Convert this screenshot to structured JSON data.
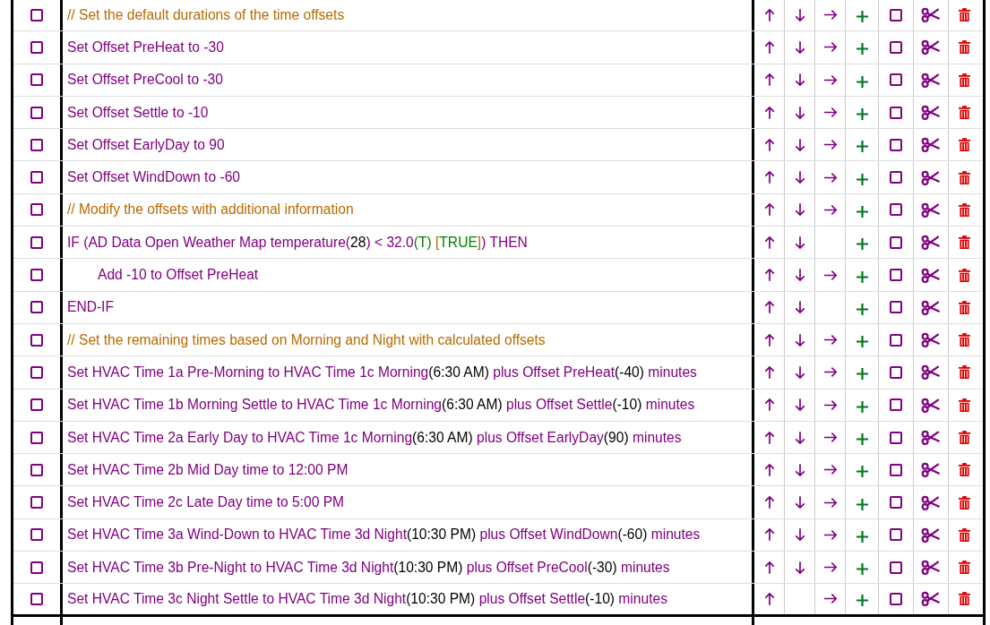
{
  "rows": [
    {
      "kind": "comment",
      "checked": false,
      "segments": [
        {
          "text": "// Set the default durations of the time offsets"
        }
      ],
      "move_up": true,
      "move_down": true,
      "indent": true,
      "marked": false
    },
    {
      "kind": "statement",
      "checked": false,
      "segments": [
        {
          "text": "Set Offset PreHeat to -30"
        }
      ],
      "move_up": true,
      "move_down": true,
      "indent": true,
      "marked": false
    },
    {
      "kind": "statement",
      "checked": false,
      "segments": [
        {
          "text": "Set Offset PreCool to -30"
        }
      ],
      "move_up": true,
      "move_down": true,
      "indent": true,
      "marked": false
    },
    {
      "kind": "statement",
      "checked": false,
      "segments": [
        {
          "text": "Set Offset Settle to -10"
        }
      ],
      "move_up": true,
      "move_down": true,
      "indent": true,
      "marked": false
    },
    {
      "kind": "statement",
      "checked": false,
      "segments": [
        {
          "text": "Set Offset EarlyDay to 90"
        }
      ],
      "move_up": true,
      "move_down": true,
      "indent": true,
      "marked": false
    },
    {
      "kind": "statement",
      "checked": false,
      "segments": [
        {
          "text": "Set Offset WindDown to -60"
        }
      ],
      "move_up": true,
      "move_down": true,
      "indent": true,
      "marked": false
    },
    {
      "kind": "comment",
      "checked": false,
      "segments": [
        {
          "text": "// Modify the offsets with additional information"
        }
      ],
      "move_up": true,
      "move_down": true,
      "indent": true,
      "marked": false
    },
    {
      "kind": "statement",
      "checked": false,
      "segments": [
        {
          "text": "IF (AD Data Open Weather Map temperature("
        },
        {
          "text": "28",
          "kind": "value"
        },
        {
          "text": ") < 32.0"
        },
        {
          "text": "(T)",
          "kind": "result"
        },
        {
          "text": " [",
          "kind": "bracket"
        },
        {
          "text": "TRUE",
          "kind": "result"
        },
        {
          "text": "]",
          "kind": "bracket"
        },
        {
          "text": ") THEN"
        }
      ],
      "move_up": true,
      "move_down": true,
      "indent": false,
      "marked": false,
      "children": [
        {
          "kind": "statement",
          "checked": false,
          "segments": [
            {
              "text": "Add -10 to Offset PreHeat"
            }
          ],
          "move_up": true,
          "move_down": true,
          "indent": true,
          "marked": false
        }
      ]
    },
    {
      "kind": "statement",
      "checked": false,
      "segments": [
        {
          "text": "END-IF"
        }
      ],
      "move_up": true,
      "move_down": true,
      "indent": false,
      "marked": false
    },
    {
      "kind": "comment",
      "checked": false,
      "segments": [
        {
          "text": "// Set the remaining times based on Morning and Night with calculated offsets"
        }
      ],
      "move_up": true,
      "move_down": true,
      "indent": true,
      "marked": false
    },
    {
      "kind": "statement",
      "checked": false,
      "segments": [
        {
          "text": "Set HVAC Time 1a Pre-Morning to HVAC Time 1c Morning"
        },
        {
          "text": "(6:30 AM)",
          "kind": "value"
        },
        {
          "text": " plus Offset PreHeat"
        },
        {
          "text": "(-40)",
          "kind": "value"
        },
        {
          "text": " minutes"
        }
      ],
      "move_up": true,
      "move_down": true,
      "indent": true,
      "marked": false
    },
    {
      "kind": "statement",
      "checked": false,
      "segments": [
        {
          "text": "Set HVAC Time 1b Morning Settle to HVAC Time 1c Morning"
        },
        {
          "text": "(6:30 AM)",
          "kind": "value"
        },
        {
          "text": " plus Offset Settle"
        },
        {
          "text": "(-10)",
          "kind": "value"
        },
        {
          "text": " minutes"
        }
      ],
      "move_up": true,
      "move_down": true,
      "indent": true,
      "marked": false
    },
    {
      "kind": "statement",
      "checked": false,
      "segments": [
        {
          "text": "Set HVAC Time 2a Early Day to HVAC Time 1c Morning"
        },
        {
          "text": "(6:30 AM)",
          "kind": "value"
        },
        {
          "text": " plus Offset EarlyDay"
        },
        {
          "text": "(90)",
          "kind": "value"
        },
        {
          "text": " minutes"
        }
      ],
      "move_up": true,
      "move_down": true,
      "indent": true,
      "marked": false
    },
    {
      "kind": "statement",
      "checked": false,
      "segments": [
        {
          "text": "Set HVAC Time 2b Mid Day time to 12:00 PM"
        }
      ],
      "move_up": true,
      "move_down": true,
      "indent": true,
      "marked": false
    },
    {
      "kind": "statement",
      "checked": false,
      "segments": [
        {
          "text": "Set HVAC Time 2c Late Day time to 5:00 PM"
        }
      ],
      "move_up": true,
      "move_down": true,
      "indent": true,
      "marked": false
    },
    {
      "kind": "statement",
      "checked": false,
      "segments": [
        {
          "text": "Set HVAC Time 3a Wind-Down to HVAC Time 3d Night"
        },
        {
          "text": "(10:30 PM)",
          "kind": "value"
        },
        {
          "text": " plus Offset WindDown"
        },
        {
          "text": "(-60)",
          "kind": "value"
        },
        {
          "text": " minutes"
        }
      ],
      "move_up": true,
      "move_down": true,
      "indent": true,
      "marked": false
    },
    {
      "kind": "statement",
      "checked": false,
      "segments": [
        {
          "text": "Set HVAC Time 3b Pre-Night to HVAC Time 3d Night"
        },
        {
          "text": "(10:30 PM)",
          "kind": "value"
        },
        {
          "text": " plus Offset PreCool"
        },
        {
          "text": "(-30)",
          "kind": "value"
        },
        {
          "text": " minutes"
        }
      ],
      "move_up": true,
      "move_down": true,
      "indent": true,
      "marked": false
    },
    {
      "kind": "statement",
      "checked": false,
      "segments": [
        {
          "text": "Set HVAC Time 3c Night Settle to HVAC Time 3d Night"
        },
        {
          "text": "(10:30 PM)",
          "kind": "value"
        },
        {
          "text": " plus Offset Settle"
        },
        {
          "text": "(-10)",
          "kind": "value"
        },
        {
          "text": " minutes"
        }
      ],
      "move_up": true,
      "move_down": false,
      "indent": true,
      "marked": false
    }
  ]
}
